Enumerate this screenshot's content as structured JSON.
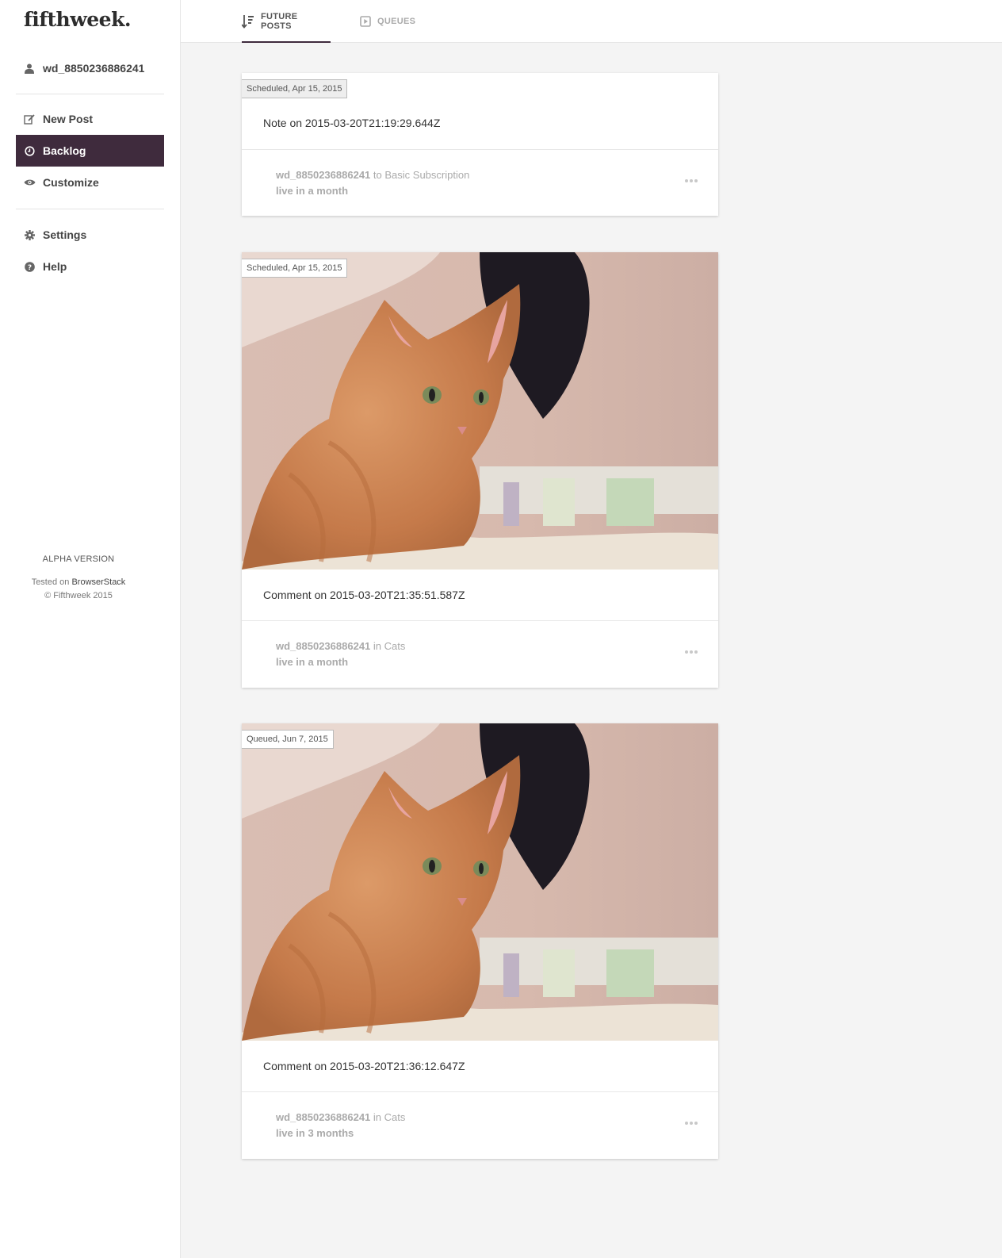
{
  "brand": "fifthweek.",
  "sidebar": {
    "user": {
      "label": "wd_8850236886241",
      "icon": "user-icon"
    },
    "items": [
      {
        "label": "New Post",
        "icon": "edit-icon",
        "active": false
      },
      {
        "label": "Backlog",
        "icon": "clock-icon",
        "active": true
      },
      {
        "label": "Customize",
        "icon": "eye-icon",
        "active": false
      }
    ],
    "items2": [
      {
        "label": "Settings",
        "icon": "gear-icon"
      },
      {
        "label": "Help",
        "icon": "help-icon"
      }
    ],
    "footer": {
      "alpha": "ALPHA VERSION",
      "tested_prefix": "Tested on",
      "tested_link": "BrowserStack",
      "copyright": "© Fifthweek 2015"
    }
  },
  "tabs": [
    {
      "label": "FUTURE POSTS",
      "icon": "sort-icon",
      "active": true
    },
    {
      "label": "QUEUES",
      "icon": "play-square-icon",
      "active": false
    }
  ],
  "posts": [
    {
      "badge": "Scheduled, Apr 15, 2015",
      "has_image": false,
      "title": "Note on 2015-03-20T21:19:29.644Z",
      "author": "wd_8850236886241",
      "connector": "to",
      "target": "Basic Subscription",
      "live": "live in a month"
    },
    {
      "badge": "Scheduled, Apr 15, 2015",
      "has_image": true,
      "title": "Comment on 2015-03-20T21:35:51.587Z",
      "author": "wd_8850236886241",
      "connector": "in",
      "target": "Cats",
      "live": "live in a month"
    },
    {
      "badge": "Queued, Jun 7, 2015",
      "has_image": true,
      "title": "Comment on 2015-03-20T21:36:12.647Z",
      "author": "wd_8850236886241",
      "connector": "in",
      "target": "Cats",
      "live": "live in 3 months"
    }
  ],
  "colors": {
    "accent": "#3f2b3d",
    "muted": "#aaaaaa"
  }
}
